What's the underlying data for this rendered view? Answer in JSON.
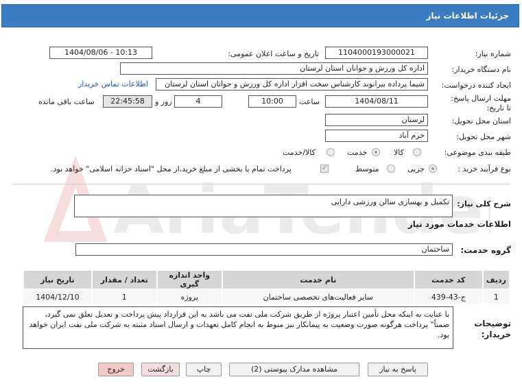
{
  "header": {
    "title": "جزئیات اطلاعات نیاز"
  },
  "fields": {
    "need_number_label": "شماره نیاز:",
    "need_number": "1104000193000021",
    "announce_label": "تاریخ و ساعت اعلان عمومی:",
    "announce_value": "1404/08/06 - 10:13",
    "buyer_label": "نام دستگاه خریدار:",
    "buyer_value": "اداره کل ورزش و جوانان استان لرستان",
    "creator_label": "ایجاد کننده درخواست:",
    "creator_value": "شیما پرداده بیرانوند کارشناس سخت افزار اداره کل ورزش و جوانان استان لرستان",
    "contact_link": "اطلاعات تماس خریدار",
    "deadline_label": "مهلت ارسال پاسخ: تا تاریخ:",
    "deadline_date": "1404/08/11",
    "time_label": "ساعت",
    "deadline_time": "10:00",
    "days_value": "4",
    "days_label": "روز و",
    "remaining_time": "22:45:58",
    "remaining_label": "ساعت باقی مانده",
    "province_label": "استان محل تحویل:",
    "province_value": "لرستان",
    "city_label": "شهر محل تحویل:",
    "city_value": "خرم آباد",
    "category_label": "طبقه بندی موضوعی:",
    "category_options": [
      "کالا",
      "خدمت",
      "کالا/خدمت"
    ],
    "category_selected": "خدمت",
    "process_label": "نوع فرآیند خرید :",
    "process_options": [
      "جزیی",
      "متوسط"
    ],
    "process_selected": "جزیی",
    "payment_note": "پرداخت تمام یا بخشی از مبلغ خرید،از محل \"اسناد خزانه اسلامی\" خواهد بود."
  },
  "description": {
    "label": "شرح کلی نیاز:",
    "value": "تکمیل و بهسازی سالن ورزشی دارایی"
  },
  "services_section": {
    "heading": "اطلاعات خدمات مورد نیاز",
    "group_label": "گروه خدمت:",
    "group_value": "ساختمان",
    "columns": [
      "ردیف",
      "کد خدمت",
      "نام خدمت",
      "واحد اندازه گیری",
      "تعداد / مقدار",
      "تاریخ نیاز"
    ],
    "rows": [
      [
        "1",
        "ج-43-439",
        "سایر فعالیت‌های تخصصی ساختمان",
        "پروژه",
        "1",
        "1404/12/10"
      ]
    ]
  },
  "buyer_notes": {
    "label": "توضیحات خریدار:",
    "value": "با عنایت به اینکه محل تأمین اعتبار پروژه از طریق شرکت ملی نفت می باشد به این قرارداد پیش پرداخت و تعدیل تعلق نمی گیرد، ضمناً\" پرداخت هرگونه صورت وضعیت به پیمانکار نیز منوط به انجام کامل تعهدات و ارسال اسناد مثبته به شرکت ملی نفت ایران خواهد بود."
  },
  "buttons": {
    "reply": "پاسخ به نیاز",
    "attachments": "مشاهده مدارک پیوستی (2)",
    "print": "چاپ",
    "back": "بازگشت",
    "exit": "خروج"
  },
  "watermark": {
    "text": "AriaTender.net"
  }
}
